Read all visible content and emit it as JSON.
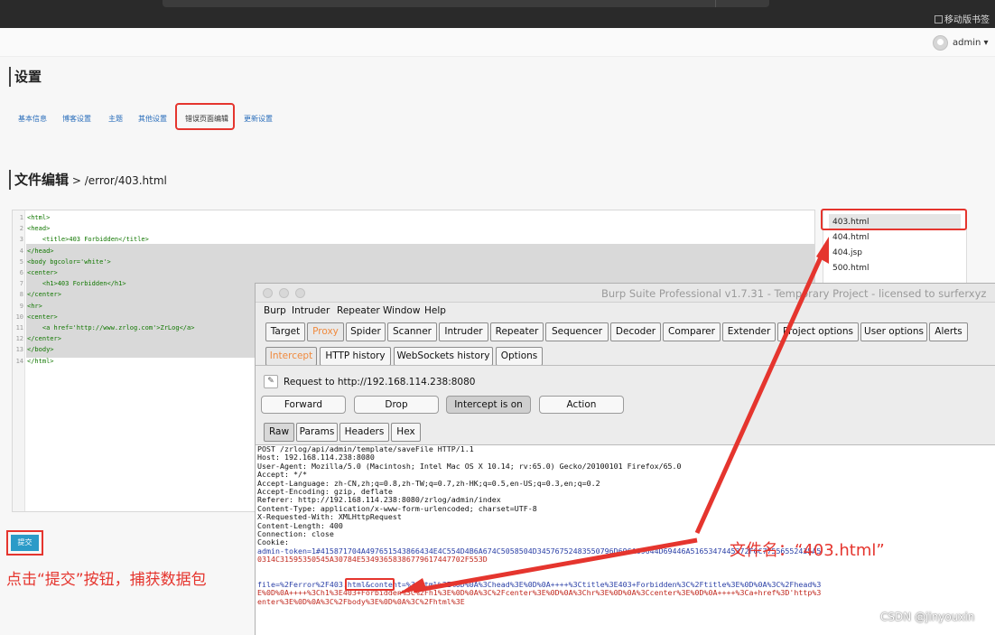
{
  "browser": {
    "bookmark_label": "移动版书签"
  },
  "user": {
    "name": "admin ▾"
  },
  "settings": {
    "title": "设置",
    "tabs": [
      "基本信息",
      "博客设置",
      "主题",
      "其他设置",
      "错误页面编辑",
      "更新设置"
    ],
    "active_tab": "错误页面编辑"
  },
  "editor": {
    "title": "文件编辑",
    "path": " > /error/403.html",
    "lines": [
      "<html>",
      "<head>",
      "    <title>403 Forbidden</title>",
      "</head>",
      "<body bgcolor='white'>",
      "<center>",
      "    <h1>403 Forbidden</h1>",
      "</center>",
      "<hr>",
      "<center>",
      "    <a href='http://www.zrlog.com'>ZrLog</a>",
      "</center>",
      "</body>",
      "</html>"
    ],
    "line_numbers": [
      "1",
      "2",
      "3",
      "4",
      "5",
      "6",
      "7",
      "8",
      "9",
      "10",
      "11",
      "12",
      "13",
      "14"
    ]
  },
  "files": [
    "403.html",
    "404.html",
    "404.jsp",
    "500.html"
  ],
  "submit_label": "提交",
  "annotations": {
    "left_note": "点击“提交”按钮，捕获数据包",
    "right_note": "文件名：“403.html”"
  },
  "burp": {
    "title": "Burp Suite Professional v1.7.31 - Temporary Project - licensed to surferxyz",
    "menu": [
      "Burp",
      "Intruder",
      "Repeater",
      "Window",
      "Help"
    ],
    "main_tabs": [
      "Target",
      "Proxy",
      "Spider",
      "Scanner",
      "Intruder",
      "Repeater",
      "Sequencer",
      "Decoder",
      "Comparer",
      "Extender",
      "Project options",
      "User options",
      "Alerts"
    ],
    "active_main_tab": "Proxy",
    "sub_tabs": [
      "Intercept",
      "HTTP history",
      "WebSockets history",
      "Options"
    ],
    "active_sub_tab": "Intercept",
    "request_to": "Request to http://192.168.114.238:8080",
    "buttons": {
      "forward": "Forward",
      "drop": "Drop",
      "intercept": "Intercept is on",
      "action": "Action"
    },
    "view_tabs": [
      "Raw",
      "Params",
      "Headers",
      "Hex"
    ],
    "request_lines": [
      "POST /zrlog/api/admin/template/saveFile HTTP/1.1",
      "Host: 192.168.114.238:8080",
      "User-Agent: Mozilla/5.0 (Macintosh; Intel Mac OS X 10.14; rv:65.0) Gecko/20100101 Firefox/65.0",
      "Accept: */*",
      "Accept-Language: zh-CN,zh;q=0.8,zh-TW;q=0.7,zh-HK;q=0.5,en-US;q=0.3,en;q=0.2",
      "Accept-Encoding: gzip, deflate",
      "Referer: http://192.168.114.238:8080/zrlog/admin/index",
      "Content-Type: application/x-www-form-urlencoded; charset=UTF-8",
      "X-Requested-With: XMLHttpRequest",
      "Content-Length: 400",
      "Connection: close",
      "Cookie:"
    ],
    "cookie_token": "admin-token=1#415871704A497651543866434E4C554D4B6A674C5058504D34576752483550796D696A69644D69446A5165347445372F6C77556552435A5",
    "cookie_token_2": "0314C31595350545A30784E53493658386779617447702F553D",
    "body_lines": [
      "file=%2Ferror%2F403.html&content=%3Chtml%3E%0D%0A%3Chead%3E%0D%0A++++%3Ctitle%3E403+Forbidden%3C%2Ftitle%3E%0D%0A%3C%2Fhead%3",
      "E%0D%0A++++%3Ch1%3E403+Forbidden%3C%2Fh1%3E%0D%0A%3C%2Fcenter%3E%0D%0A%3Chr%3E%0D%0A%3Ccenter%3E%0D%0A++++%3Ca+href%3D'http%3",
      "enter%3E%0D%0A%3C%2Fbody%3E%0D%0A%3C%2Fhtml%3E"
    ]
  },
  "watermark": "CSDN @jinyouxin",
  "colors": {
    "annotation_red": "#e5352e",
    "submit_blue": "#2b9bc8",
    "proxy_orange": "#f08a3e"
  }
}
